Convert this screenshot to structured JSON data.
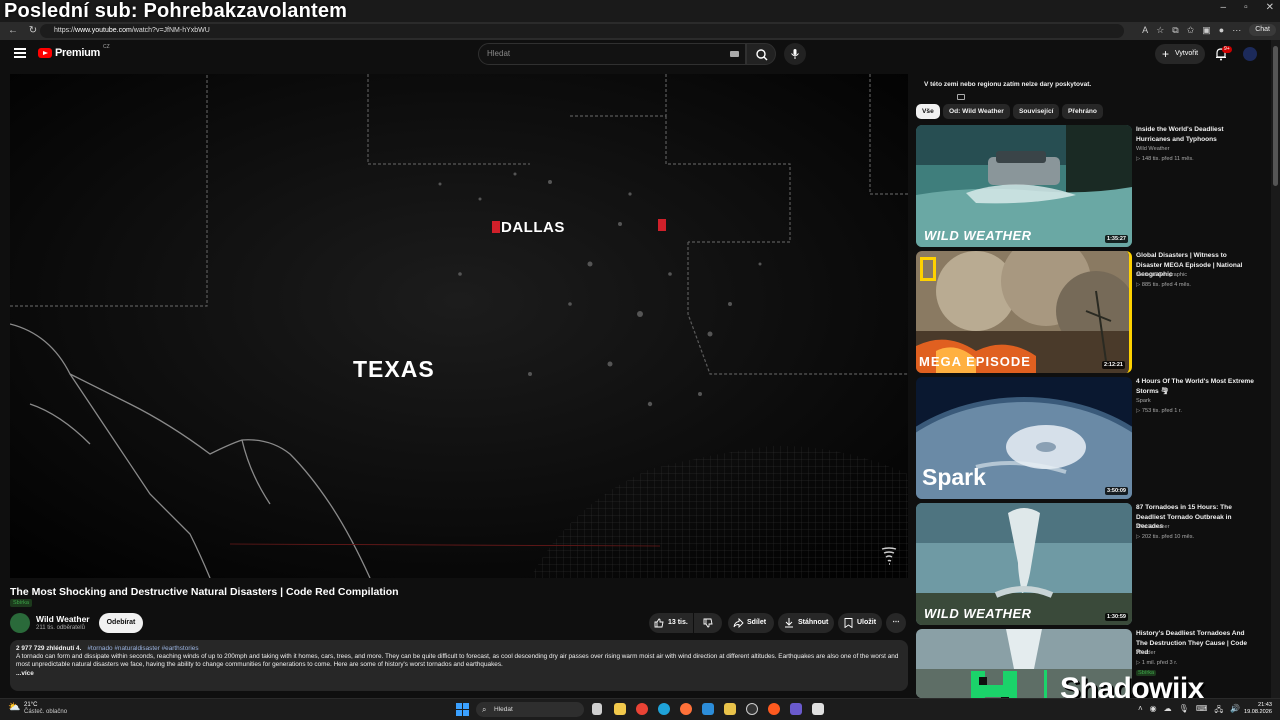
{
  "overlay": {
    "title": "Poslední sub: Pohrebakzavolantem"
  },
  "browser": {
    "url_prefix": "https://",
    "url_host": "www.youtube.com",
    "url_path": "/watch?v=JfNM-hYxbWU",
    "chat_label": "Chat"
  },
  "header": {
    "logo_text": "Premium",
    "logo_region": "CZ",
    "search_placeholder": "Hledat",
    "create_label": "Vytvořit",
    "notif_count": "9+"
  },
  "player": {
    "map_labels": {
      "city": "DALLAS",
      "state": "TEXAS"
    }
  },
  "video": {
    "title": "The Most Shocking and Destructive Natural Disasters | Code Red Compilation",
    "collection_tag": "Sbírka",
    "channel": "Wild Weather",
    "subscribers": "211 tis. odběratelů",
    "subscribe_label": "Odebírat",
    "likes": "13 tis.",
    "share_label": "Sdílet",
    "download_label": "Stáhnout",
    "save_label": "Uložit",
    "description": {
      "stats": "2 977 729 zhlédnutí  4.",
      "tags": "#tornado #naturaldisaster #earthstories",
      "text": "A tornado can form and dissipate within seconds, reaching winds of up to 200mph and taking with it homes, cars, trees, and more.  They can be quite difficult to forecast, as cool descending dry air passes over rising warm moist air with wind direction at different altitudes. Earthquakes are also one of the worst and most unpredictable natural disasters we face, having the ability to change communities for generations to come.  Here are some of history's worst tornados and earthquakes.",
      "more_label": "...více"
    }
  },
  "sidebar": {
    "donation_note": "V této zemi nebo regionu zatím nelze dary poskytovat.",
    "chips": [
      "Vše",
      "Od: Wild Weather",
      "Související",
      "Přehráno"
    ],
    "recommendations": [
      {
        "title": "Inside the World's Deadliest Hurricanes and Typhoons",
        "channel": "Wild Weather",
        "meta": "▷ 148 tis.   před 11 měs.",
        "duration": "1:35:27",
        "brand": "WILD WEATHER"
      },
      {
        "title": "Global Disasters | Witness to Disaster MEGA Episode | National Geographic",
        "channel": "National Geographic",
        "meta": "▷ 885 tis.   před 4 měs.",
        "duration": "2:12:21",
        "brand": "MEGA EPISODE"
      },
      {
        "title": "4 Hours Of The World's Most Extreme Storms 🌪",
        "channel": "Spark",
        "meta": "▷ 753 tis.   před 1 r.",
        "duration": "3:50:09",
        "brand": "Spark"
      },
      {
        "title": "87 Tornadoes in 15 Hours: The Deadliest Tornado Outbreak in Decades",
        "channel": "Wild Weather",
        "meta": "▷ 202 tis.   před 10 měs.",
        "duration": "1:30:59",
        "brand": "WILD WEATHER"
      },
      {
        "title": "History's Deadliest Tornadoes And The Destruction They Cause | Code Red",
        "channel": "Wonder",
        "meta": "▷ 1 mil.   před 3 r.",
        "tag": "Sbírka"
      }
    ]
  },
  "watermark": {
    "text": "Shadowjix"
  },
  "taskbar": {
    "weather_temp": "21°C",
    "weather_desc": "Částeč. oblačno",
    "search_placeholder": "Hledat",
    "time": "21:43",
    "date": "19.08.2026"
  }
}
